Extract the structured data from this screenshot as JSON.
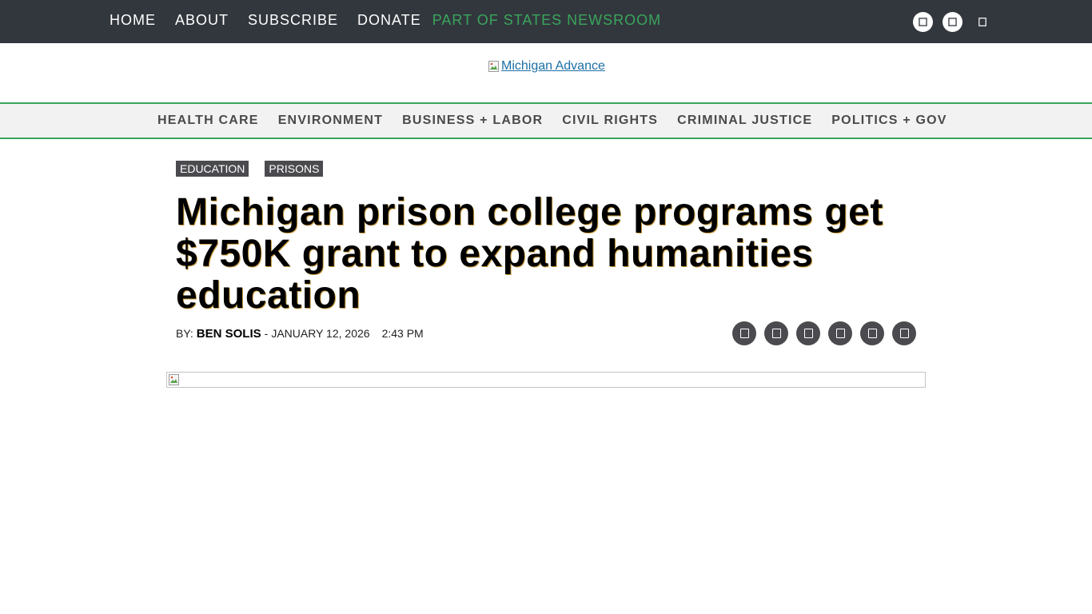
{
  "top_nav": {
    "items": [
      "HOME",
      "ABOUT",
      "SUBSCRIBE",
      "DONATE"
    ],
    "network_label": "PART OF STATES NEWSROOM",
    "social_icons": [
      "facebook-icon",
      "twitter-icon"
    ],
    "search_icon": "search-icon"
  },
  "logo": {
    "alt": "Michigan Advance"
  },
  "category_nav": {
    "items": [
      "HEALTH CARE",
      "ENVIRONMENT",
      "BUSINESS + LABOR",
      "CIVIL RIGHTS",
      "CRIMINAL JUSTICE",
      "POLITICS + GOV"
    ]
  },
  "article": {
    "tags": [
      "EDUCATION",
      "PRISONS"
    ],
    "headline": "Michigan prison college programs get $750K grant to expand humanities education",
    "byline": {
      "by_label": "BY:",
      "author": "BEN SOLIS",
      "separator": "-",
      "date": "JANUARY 12, 2026",
      "time": "2:43 PM"
    },
    "share_icons": [
      "facebook-share-icon",
      "twitter-share-icon",
      "linkedin-share-icon",
      "email-share-icon",
      "print-share-icon",
      "republish-icon"
    ]
  },
  "colors": {
    "topbar_bg": "#32373d",
    "accent_green": "#3aa55c",
    "catnav_bg": "#f2f2f2",
    "tag_bg": "#4b4b4f",
    "logo_link": "#1d6fa5"
  }
}
